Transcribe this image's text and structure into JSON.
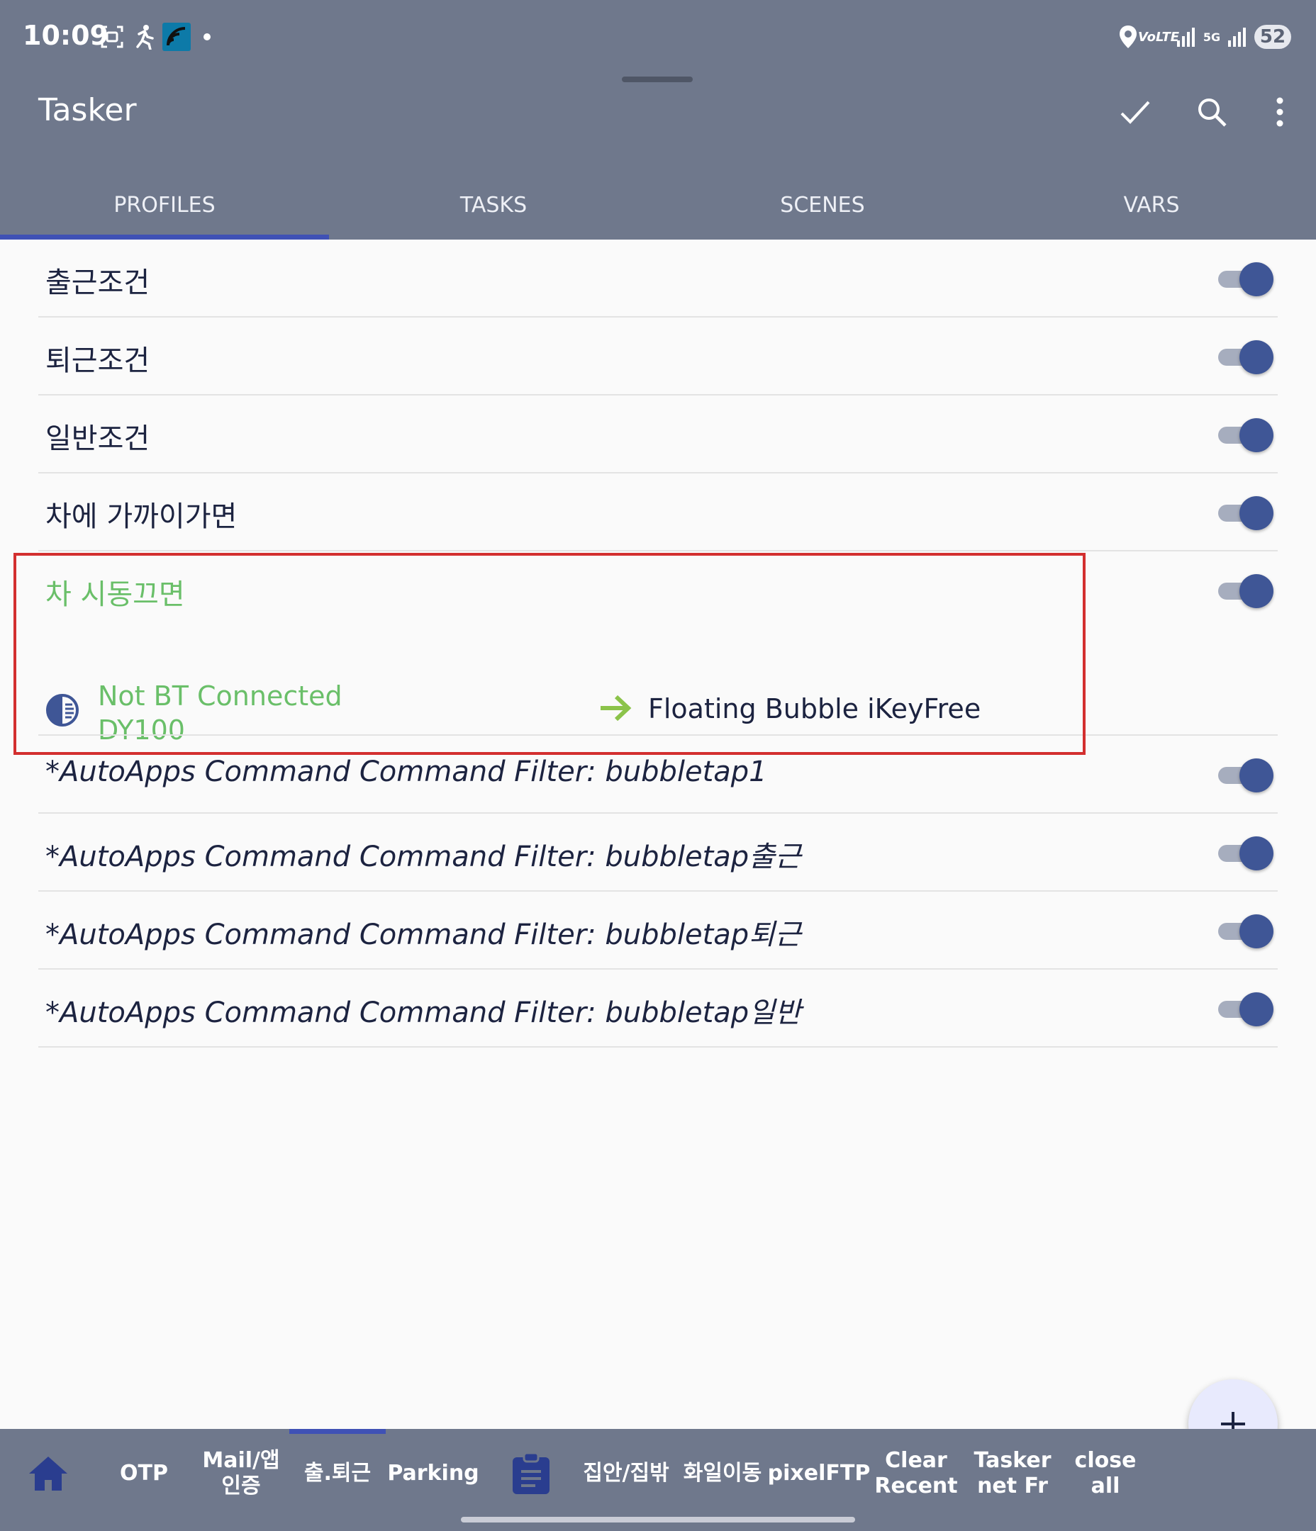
{
  "status_bar": {
    "time": "10:09",
    "network": "VoLTE",
    "network_type": "5G",
    "battery": "52",
    "icons": [
      "screenshot-icon",
      "activity-icon",
      "wifi-app-icon",
      "dot-icon",
      "location-icon",
      "signal-icon",
      "signal-5g-icon",
      "signal-icon-2",
      "battery-icon"
    ]
  },
  "app_bar": {
    "title": "Tasker",
    "actions": [
      "check-icon",
      "search-icon",
      "more-vert-icon"
    ]
  },
  "tabs": [
    {
      "label": "PROFILES",
      "active": true
    },
    {
      "label": "TASKS",
      "active": false
    },
    {
      "label": "SCENES",
      "active": false
    },
    {
      "label": "VARS",
      "active": false
    }
  ],
  "profiles": [
    {
      "name": "출근조건",
      "enabled": true
    },
    {
      "name": "퇴근조건",
      "enabled": true
    },
    {
      "name": "일반조건",
      "enabled": true
    },
    {
      "name": "차에 가까이가면",
      "enabled": true
    },
    {
      "name": "차 시동끄면",
      "enabled": true,
      "context": "Not BT Connected\nDY100",
      "context_icon": "bluetooth-state-icon",
      "task": "Floating Bubble iKeyFree"
    },
    {
      "name": "*AutoApps Command Command Filter: bubbletap1",
      "enabled": true
    },
    {
      "name": "*AutoApps Command Command Filter: bubbletap출근",
      "enabled": true
    },
    {
      "name": "*AutoApps Command Command Filter: bubbletap퇴근",
      "enabled": true
    },
    {
      "name": "*AutoApps Command Command Filter: bubbletap일반",
      "enabled": true
    }
  ],
  "expanded": {
    "context_line1": "Not BT Connected",
    "context_line2": "DY100",
    "task": "Floating Bubble iKeyFree"
  },
  "fab": {
    "icon": "plus-icon"
  },
  "bottom_bar": {
    "items": [
      {
        "label": "",
        "icon": "home-icon"
      },
      {
        "label": "OTP"
      },
      {
        "label": "Mail/앱\n인증"
      },
      {
        "label": "출.퇴근",
        "active": true
      },
      {
        "label": "Parking"
      },
      {
        "label": "",
        "icon": "clipboard-icon"
      },
      {
        "label": "집안/집밖"
      },
      {
        "label": "화일이동"
      },
      {
        "label": "pixelFTP"
      },
      {
        "label": "Clear\nRecent"
      },
      {
        "label": "Tasker\nnet Fr"
      },
      {
        "label": "close all"
      }
    ]
  },
  "colors": {
    "header": "#6f788c",
    "tab_indicator": "#3f51b5",
    "toggle_thumb": "#3f5696",
    "expanded_green": "#6abf69",
    "highlight_red": "#d32f2f",
    "task_arrow": "#8bc34a"
  }
}
